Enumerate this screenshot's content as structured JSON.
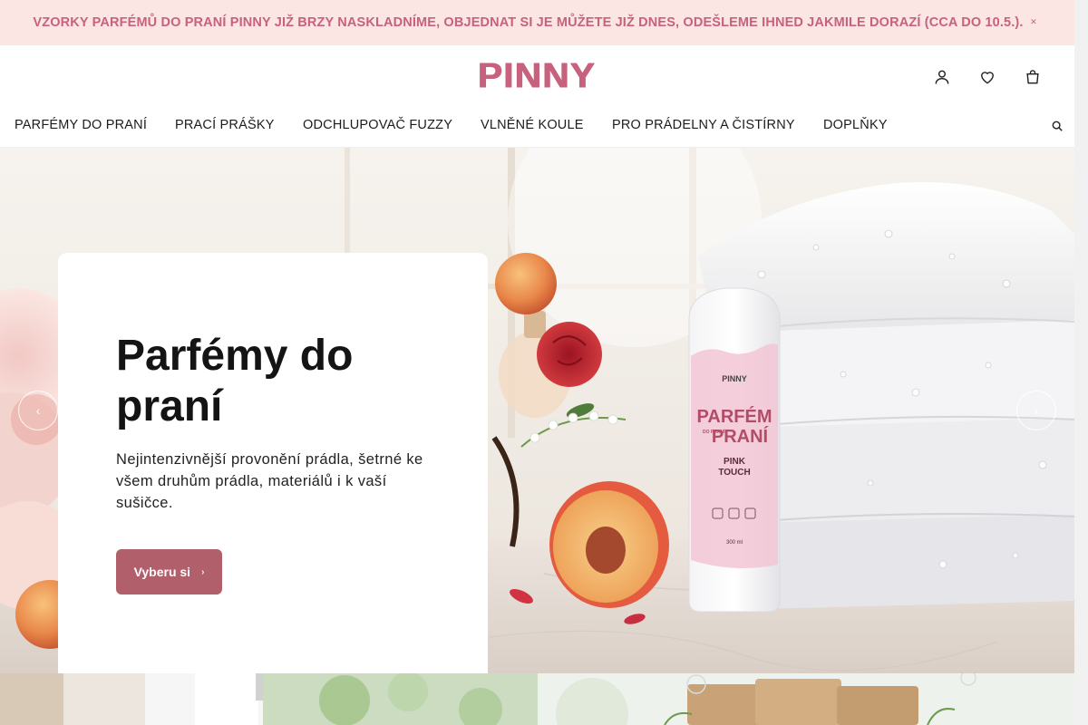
{
  "announcement": {
    "text": "VZORKY PARFÉMŮ DO PRANÍ PINNY JIŽ BRZY NASKLADNÍME, OBJEDNAT SI JE MŮŽETE JIŽ DNES, ODEŠLEME IHNED JAKMILE DORAZÍ (CCA DO 10.5.).",
    "close_icon": "close-icon"
  },
  "header": {
    "logo_text": "PINNY",
    "icons": [
      "user-icon",
      "heart-icon",
      "cart-icon"
    ]
  },
  "nav": {
    "items": [
      {
        "label": "PARFÉMY DO PRANÍ"
      },
      {
        "label": "PRACÍ PRÁŠKY"
      },
      {
        "label": "ODCHLUPOVAČ FUZZY"
      },
      {
        "label": "VLNĚNÉ KOULE"
      },
      {
        "label": "PRO PRÁDELNY A ČISTÍRNY"
      },
      {
        "label": "DOPLŇKY"
      }
    ],
    "search_icon": "search-icon"
  },
  "hero": {
    "title": "Parfémy do praní",
    "description": "Nejintenzivnější provonění prádla, šetrné ke všem druhům prádla, materiálů i k vaší sušičce.",
    "button_label": "Vyberu si",
    "product": {
      "brand": "PINNY",
      "name_line1": "PARFÉM",
      "name_small": "DO PRANÍ",
      "name_line2": "PRANÍ",
      "variant_line1": "PINK",
      "variant_line2": "TOUCH",
      "volume": "300 ml"
    },
    "prev_icon": "chevron-left-icon",
    "next_icon": "chevron-right-icon"
  },
  "colors": {
    "accent": "#c7617d",
    "button": "#b25f6c",
    "announcement_bg": "#fbe6e4"
  }
}
